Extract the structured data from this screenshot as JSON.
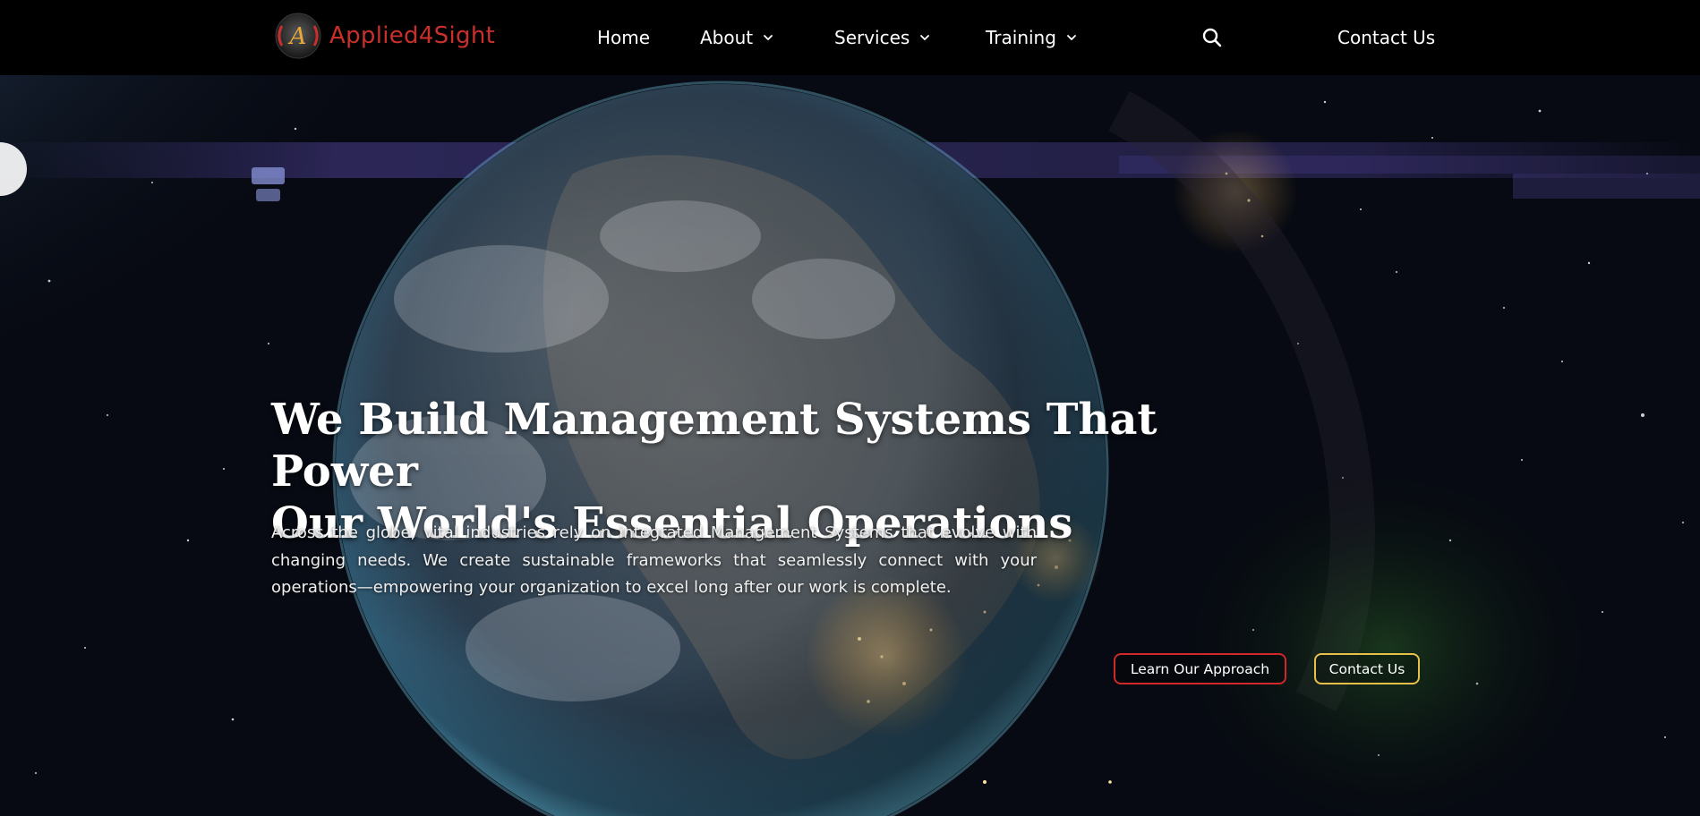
{
  "brand": {
    "name": "Applied4Sight",
    "logo_letter": "A",
    "color": "#c9302c"
  },
  "nav": {
    "home": "Home",
    "about": "About",
    "services": "Services",
    "training": "Training",
    "search_icon": "search-icon",
    "contact": "Contact Us"
  },
  "hero": {
    "headline_line1": "We Build Management Systems That Power",
    "headline_line2": "Our World's Essential Operations",
    "body": "Across the globe, vital industries rely on integrated Management Systems that evolve with changing needs. We create sustainable frameworks that seamlessly connect with your operations—empowering your organization to excel long after our work is complete.",
    "primary_button": "Learn Our Approach",
    "secondary_button": "Contact Us"
  },
  "colors": {
    "nav_background": "#000000",
    "primary_button_border": "#d0282b",
    "secondary_button_border": "#e7c04a"
  }
}
